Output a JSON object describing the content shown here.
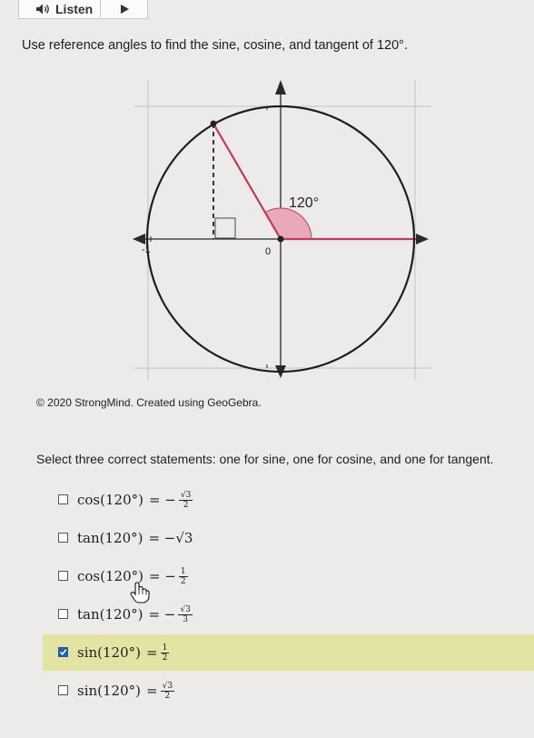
{
  "listen": {
    "label": "Listen"
  },
  "question": {
    "prompt": "Use reference angles to find the sine, cosine, and tangent of 120°."
  },
  "figure": {
    "angle_label": "120°",
    "origin_label": "0",
    "neg_one_label": "-1",
    "credit": "© 2020 StrongMind. Created using GeoGebra."
  },
  "instruction": "Select three correct statements: one for sine, one for cosine, and one for tangent.",
  "options": [
    {
      "func": "cos(120°)",
      "eq": "= −",
      "num": "√3",
      "den": "2",
      "checked": false
    },
    {
      "func": "tan(120°)",
      "eq": "= −√3",
      "num": "",
      "den": "",
      "checked": false
    },
    {
      "func": "cos(120°)",
      "eq": "= −",
      "num": "1",
      "den": "2",
      "checked": false
    },
    {
      "func": "tan(120°)",
      "eq": "= −",
      "num": "√3",
      "den": "3",
      "checked": false
    },
    {
      "func": "sin(120°)",
      "eq": "=",
      "num": "1",
      "den": "2",
      "checked": true
    },
    {
      "func": "sin(120°)",
      "eq": "=",
      "num": "√3",
      "den": "2",
      "checked": false
    }
  ],
  "colors": {
    "terminal_side": "#c03a5e",
    "angle_fill": "#e9a9bb",
    "checkbox_checked": "#1f5fa8",
    "selected_row": "#e3e4a4"
  }
}
